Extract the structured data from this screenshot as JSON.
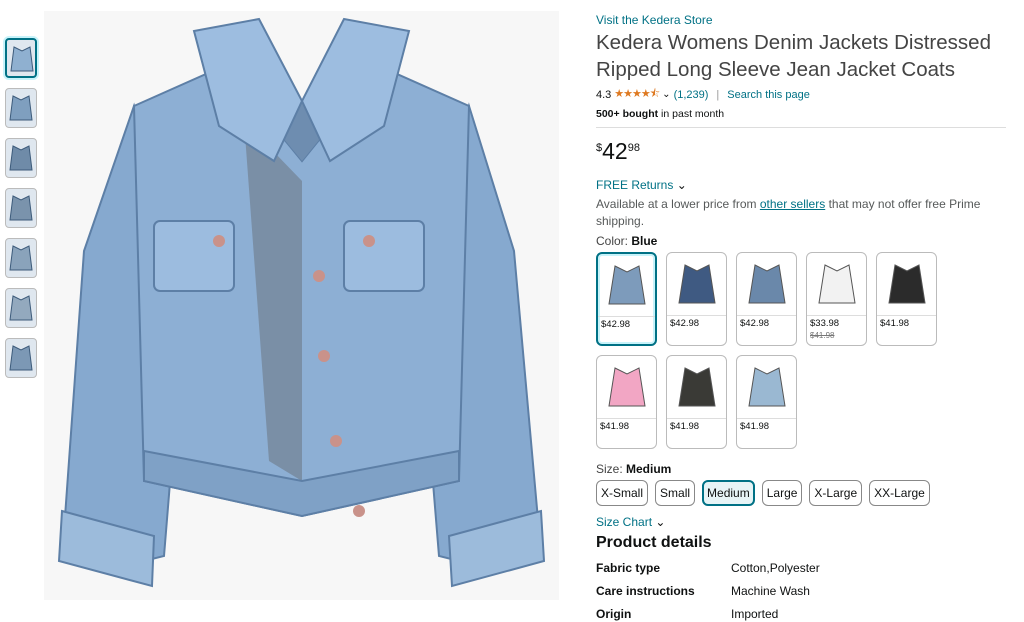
{
  "store": {
    "link": "Visit the Kedera Store"
  },
  "product": {
    "title": "Kedera Womens Denim Jackets Distressed Ripped Long Sleeve Jean Jacket Coats",
    "rating": "4.3",
    "stars": "★★★★⯪",
    "reviews": "(1,239)",
    "search_page": "Search this page",
    "bought_bold": "500+ bought",
    "bought_rest": " in past month"
  },
  "price": {
    "symbol": "$",
    "whole": "42",
    "fraction": "98"
  },
  "returns": {
    "label": "FREE Returns"
  },
  "lower": {
    "prefix": "Available at a lower price from ",
    "link": "other sellers",
    "suffix": " that may not offer free Prime shipping."
  },
  "color": {
    "label": "Color: ",
    "selected": "Blue",
    "swatches": [
      {
        "price": "$42.98",
        "was": "",
        "color": "#7d9bbb"
      },
      {
        "price": "$42.98",
        "was": "",
        "color": "#3f5a82"
      },
      {
        "price": "$42.98",
        "was": "",
        "color": "#6a88aa"
      },
      {
        "price": "$33.98",
        "was": "$41.98",
        "color": "#f2f2f2"
      },
      {
        "price": "$41.98",
        "was": "",
        "color": "#2b2b2b"
      },
      {
        "price": "$41.98",
        "was": "",
        "color": "#f2a6c4"
      },
      {
        "price": "$41.98",
        "was": "",
        "color": "#3a3a36"
      },
      {
        "price": "$41.98",
        "was": "",
        "color": "#9ab8d2"
      }
    ]
  },
  "size": {
    "label": "Size: ",
    "selected": "Medium",
    "options": [
      "X-Small",
      "Small",
      "Medium",
      "Large",
      "X-Large",
      "XX-Large"
    ],
    "chart_link": "Size Chart"
  },
  "details": {
    "title": "Product details",
    "rows": [
      {
        "k": "Fabric type",
        "v": "Cotton,Polyester"
      },
      {
        "k": "Care instructions",
        "v": "Machine Wash"
      },
      {
        "k": "Origin",
        "v": "Imported"
      }
    ]
  },
  "thumbnail_colors": [
    "#8fb0d0",
    "#7f9fbf",
    "#6f8ba8",
    "#7a93ac",
    "#8aa3bb",
    "#93a9be",
    "#7c98b5"
  ],
  "jacket_color": "#86a9cf"
}
